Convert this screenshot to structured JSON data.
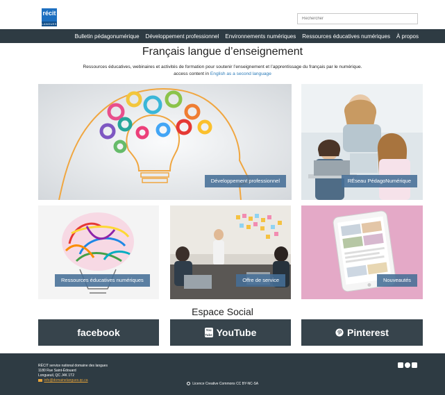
{
  "header": {
    "logo_text": "récit",
    "logo_sub": "LANGUES",
    "search_placeholder": "Rechercher"
  },
  "nav": {
    "items": [
      "Bulletin pédagonumérique",
      "Développement professionnel",
      "Environnements numériques",
      "Ressources éducatives numériques",
      "À propos"
    ]
  },
  "main": {
    "title": "Français langue d’enseignement",
    "subtitle": "Ressources éducatives, webinaires et activités de formation pour soutenir l’enseignement et l’apprentissage du français par le numérique.",
    "access_prefix": "access content in",
    "access_link": "English as a second language"
  },
  "tiles": {
    "dev": "Développement professionnel",
    "reseau": "RÉseau PédagoNumérique",
    "ressources": "Ressources éducatives numériques",
    "offre": "Offre de service",
    "nouveautes": "Nouveautés"
  },
  "social": {
    "title": "Espace Social",
    "facebook": "facebook",
    "youtube": "YouTube",
    "youtube_icon_text": "You Tube",
    "pinterest": "Pinterest"
  },
  "footer": {
    "org": "RÉCIT service national domaine des langues",
    "street": "1180 Rue Saint-Édouard",
    "city": "Longueuil, QC J4K 1T2",
    "email": "info@domainelangues.qc.ca",
    "license": "Licence Creative Commons CC BY-NC-SA"
  }
}
